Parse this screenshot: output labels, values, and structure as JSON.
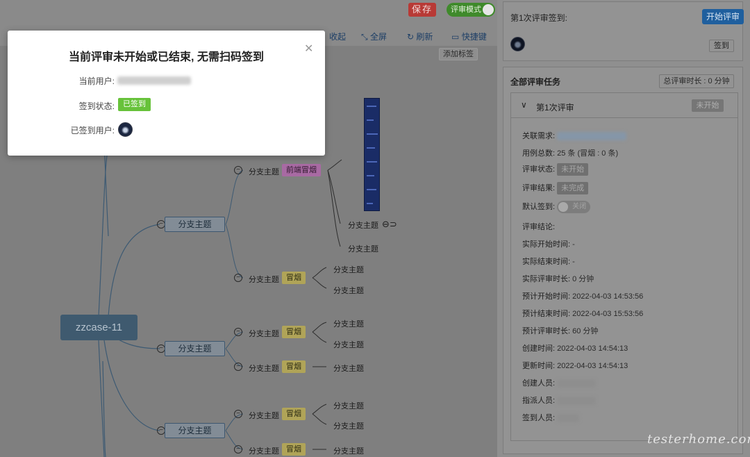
{
  "toolbar": {
    "save_label": "保存",
    "review_mode_label": "评审模式",
    "collapse_label": "收起",
    "fullscreen_label": "全屏",
    "refresh_label": "刷新",
    "shortcut_label": "快捷键",
    "add_tag_label": "添加标签"
  },
  "mindmap": {
    "root": "zzcase-11",
    "branch_label": "分支主题",
    "tag_smoke": "冒烟",
    "tag_frontend_smoke": "前端冒烟"
  },
  "modal": {
    "title": "当前评审未开始或已结束, 无需扫码签到",
    "current_user_label": "当前用户:",
    "checkin_status_label": "签到状态:",
    "checkin_status_value": "已签到",
    "signed_users_label": "已签到用户:"
  },
  "sidebar": {
    "checkin_title": "第1次评审签到:",
    "start_review_label": "开始评审",
    "checkin_button_label": "签到",
    "all_tasks_title": "全部评审任务",
    "total_duration": "总评审时长 : 0 分钟",
    "review": {
      "title": "第1次评审",
      "status_badge": "未开始",
      "fields": {
        "related_req_label": "关联需求:",
        "case_total_label": "用例总数:",
        "case_total_value": "25 条 (冒烟 : 0 条)",
        "review_status_label": "评审状态:",
        "review_status_value": "未开始",
        "review_result_label": "评审结果:",
        "review_result_value": "未完成",
        "default_checkin_label": "默认签到:",
        "default_checkin_value": "关闭",
        "conclusion_label": "评审结论:",
        "actual_start_label": "实际开始时间:",
        "actual_start_value": "-",
        "actual_end_label": "实际结束时间:",
        "actual_end_value": "-",
        "actual_duration_label": "实际评审时长:",
        "actual_duration_value": "0 分钟",
        "planned_start_label": "预计开始时间:",
        "planned_start_value": "2022-04-03 14:53:56",
        "planned_end_label": "预计结束时间:",
        "planned_end_value": "2022-04-03 15:53:56",
        "planned_duration_label": "预计评审时长:",
        "planned_duration_value": "60 分钟",
        "created_label": "创建时间:",
        "created_value": "2022-04-03 14:54:13",
        "updated_label": "更新时间:",
        "updated_value": "2022-04-03 14:54:13",
        "creator_label": "创建人员:",
        "assignee_label": "指派人员:",
        "checkin_users_label": "签到人员:"
      }
    }
  },
  "watermark": "testerhome.com",
  "colors": {
    "primary": "#409eff",
    "success": "#67c23a",
    "danger": "#f56c6c",
    "overlay": "rgba(0,0,0,0.5)"
  }
}
